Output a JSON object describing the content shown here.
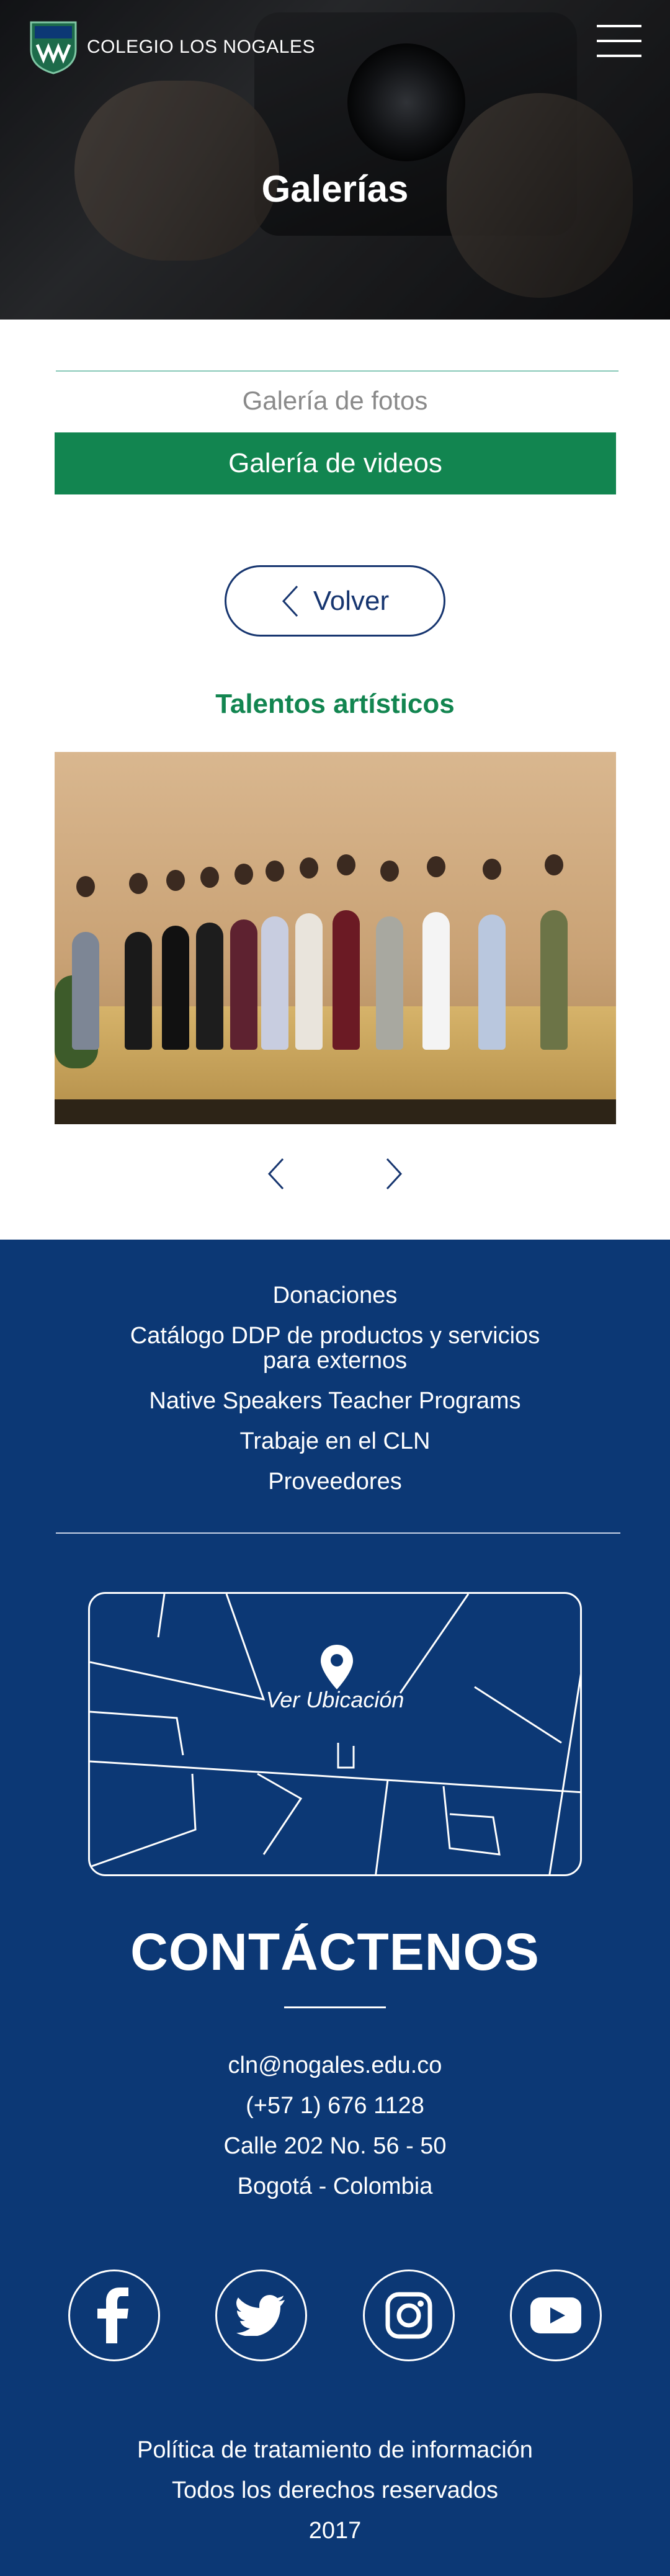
{
  "header": {
    "brand_name": "COLEGIO LOS NOGALES",
    "menu_icon": "hamburger-icon",
    "hero_title": "Galerías"
  },
  "tabs": {
    "photos": "Galería de fotos",
    "videos": "Galería de videos"
  },
  "navigation": {
    "back_label": "Volver"
  },
  "gallery": {
    "title": "Talentos artísticos",
    "prev_icon": "chevron-left-icon",
    "next_icon": "chevron-right-icon"
  },
  "footer": {
    "links": [
      "Donaciones",
      "Catálogo DDP de productos y servicios para externos",
      "Native Speakers Teacher Programs",
      "Trabaje en el CLN",
      "Proveedores"
    ],
    "map_label": "Ver Ubicación",
    "contact_title": "CONTÁCTENOS",
    "email": "cln@nogales.edu.co",
    "phone": "(+57 1) 676 1128",
    "address": "Calle 202 No. 56 - 50",
    "city": "Bogotá - Colombia",
    "social": [
      "facebook-icon",
      "twitter-icon",
      "instagram-icon",
      "youtube-icon"
    ],
    "legal": {
      "policy": "Política de tratamiento de información",
      "rights": "Todos los derechos reservados",
      "year": "2017"
    }
  },
  "colors": {
    "brand_green": "#128550",
    "navy": "#0c3875",
    "accent_rule": "#89c9b8"
  }
}
